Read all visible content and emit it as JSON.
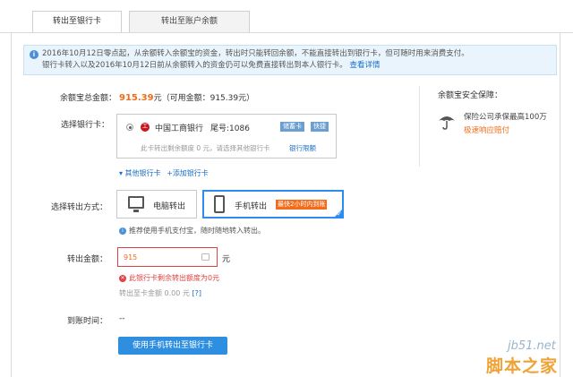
{
  "tabs": {
    "active": "转出至银行卡",
    "inactive": "转出至账户余额"
  },
  "notice": {
    "line1": "2016年10月12日零点起，从余额转入余额宝的资金，转出时只能转回余额，不能直接转出到银行卡，但可随时用来消费支付。",
    "line2": "银行卡转入以及2016年10月12日前从余额转入的资金仍可以免费直接转出到本人银行卡。",
    "link": "查看详情"
  },
  "balance": {
    "label": "余额宝总金额：",
    "amount": "915.39",
    "suffix": "元（可用金额：915.39元）"
  },
  "bank_card": {
    "label": "选择银行卡：",
    "bank_name": "中国工商银行",
    "tail": "尾号:1086",
    "badge_type": "储蓄卡",
    "badge_fast": "快捷",
    "sub_text": "此卡转出剩余额度 0 元，请选择其他银行卡",
    "limit_link": "银行限额",
    "other_cards": "▾ 其他银行卡",
    "add_card": "+添加银行卡"
  },
  "method": {
    "label": "选择转出方式：",
    "pc": "电脑转出",
    "phone": "手机转出",
    "fast_badge": "最快2小时内到账",
    "recommend": "推荐使用手机支付宝，随时随地转入转出。"
  },
  "amount": {
    "label": "转出金额：",
    "value": "915",
    "unit": "元",
    "error": "此银行卡剩余转出额度为0元",
    "tocard_prefix": "转出至卡金额 0.00 元",
    "tocard_help": "[?]"
  },
  "arrival": {
    "label": "到账时间：",
    "value": "--"
  },
  "submit": {
    "label": "使用手机转出至银行卡"
  },
  "safety": {
    "title": "余额宝安全保障：",
    "line1": "保险公司承保最高100万",
    "line2": "极速响应赔付"
  },
  "watermark": {
    "site": "jb51.net",
    "cn": "脚本之家"
  },
  "colors": {
    "accent_blue": "#2e8ee0",
    "orange": "#f26c1b",
    "error_red": "#e04141"
  }
}
